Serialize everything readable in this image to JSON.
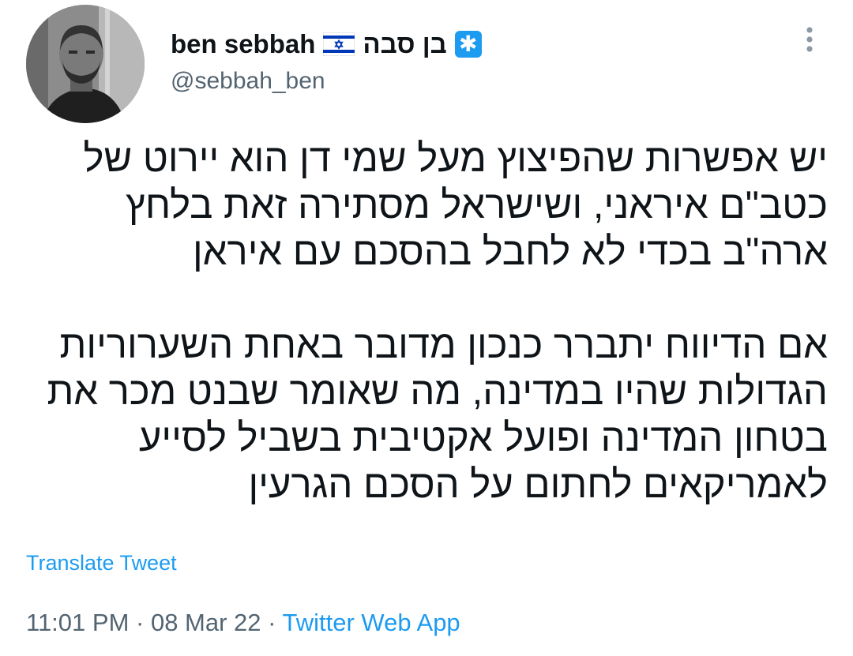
{
  "author": {
    "display_name": "ben sebbah",
    "display_name_hebrew": "בן סבה",
    "handle": "@sebbah_ben",
    "flag_icon": "israel-flag-icon",
    "badge_icon": "blue-asterisk-icon",
    "avatar_icon": "profile-photo"
  },
  "tweet": {
    "lines": [
      "יש אפשרות שהפיצוץ מעל שמי דן הוא יירוט של",
      "כטב\"ם איראני, ושישראל מסתירה זאת בלחץ",
      "ארה\"ב בכדי לא לחבל בהסכם עם איראן",
      "",
      "אם הדיווח יתברר כנכון מדובר באחת השערוריות",
      "הגדולות שהיו במדינה, מה שאומר שבנט מכר את",
      "בטחון המדינה ופועל אקטיבית בשביל לסייע",
      "לאמריקאים לחתום על הסכם הגרעין"
    ]
  },
  "translate_label": "Translate Tweet",
  "meta": {
    "time": "11:01 PM",
    "separator": " · ",
    "date": "08 Mar 22",
    "source": "Twitter Web App"
  },
  "colors": {
    "text": "#0f1419",
    "secondary": "#536471",
    "accent": "#1d9bf0"
  },
  "more_icon": "vertical-ellipsis-icon"
}
